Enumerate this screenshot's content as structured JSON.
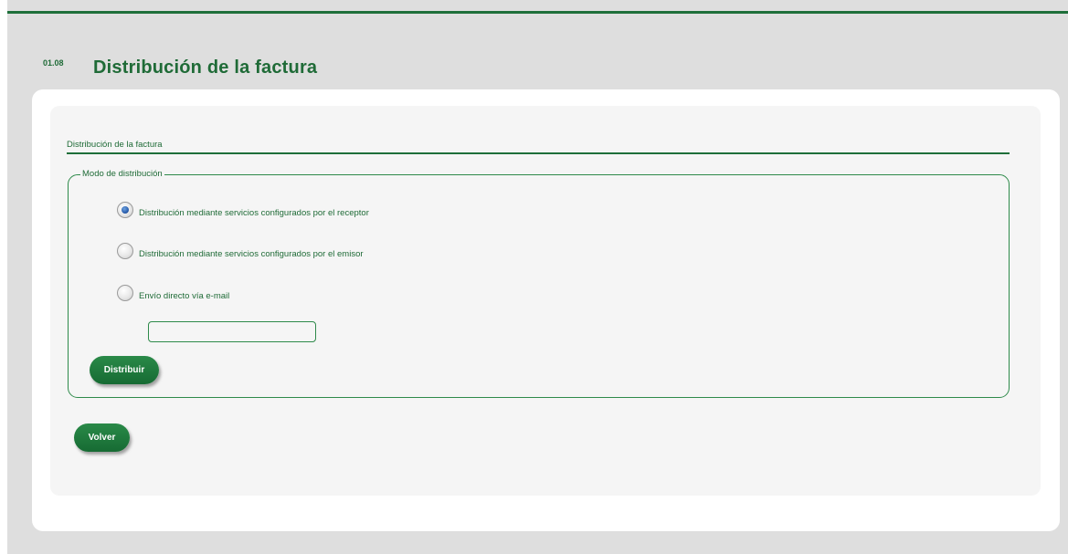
{
  "header": {
    "section_number": "01.08",
    "title": "Distribución de la factura"
  },
  "form": {
    "subsection_title": "Distribución de la factura",
    "fieldset_legend": "Modo de distribución",
    "options": [
      {
        "label": "Distribución mediante servicios configurados por el receptor",
        "checked": true
      },
      {
        "label": "Distribución mediante servicios configurados por el emisor",
        "checked": false
      },
      {
        "label": "Envío directo vía e-mail",
        "checked": false
      }
    ],
    "email_value": "",
    "distribute_label": "Distribuir"
  },
  "footer": {
    "back_label": "Volver"
  },
  "colors": {
    "brand_green": "#1f6b37",
    "page_background": "#dedede",
    "panel_background": "#f5f5f5"
  }
}
